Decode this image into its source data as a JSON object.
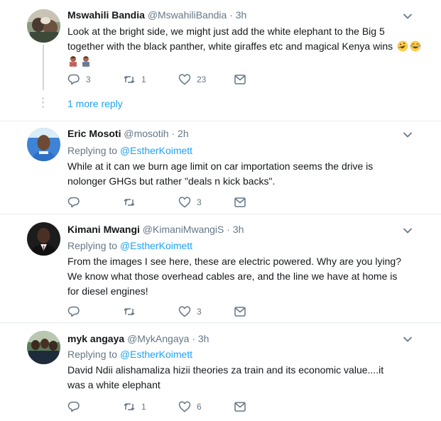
{
  "tweets": [
    {
      "name": "Mswahili Bandia",
      "handle": "@MswahiliBandia",
      "time": "3h",
      "replying_label": "",
      "replying_to": "",
      "text": "Look at the bright side, we might just add the white elephant to the Big 5 together with the black panther, white giraffes etc and magical Kenya wins",
      "reply_count": "3",
      "retweet_count": "1",
      "like_count": "23",
      "more_replies": "1 more reply"
    },
    {
      "name": "Eric Mosoti",
      "handle": "@mosotih",
      "time": "2h",
      "replying_label": "Replying to",
      "replying_to": "@EstherKoimett",
      "text": "While at it can we burn age limit on car importation seems the drive is nolonger GHGs but rather \"deals n kick backs\".",
      "reply_count": "",
      "retweet_count": "",
      "like_count": "3"
    },
    {
      "name": "Kimani Mwangi",
      "handle": "@KimaniMwangiS",
      "time": "3h",
      "replying_label": "Replying to",
      "replying_to": "@EstherKoimett",
      "text": "From the images I see here, these are electric powered. Why are you lying? We know what those overhead cables are, and the line we have at home is for diesel engines!",
      "reply_count": "",
      "retweet_count": "",
      "like_count": "3"
    },
    {
      "name": "myk angaya",
      "handle": "@MykAngaya",
      "time": "3h",
      "replying_label": "Replying to",
      "replying_to": "@EstherKoimett",
      "text": "David Ndii alishamaliza hizii theories za train and its economic value....it was a white elephant",
      "reply_count": "",
      "retweet_count": "1",
      "like_count": "6"
    }
  ],
  "dot": "·",
  "colors": {
    "link": "#1da1f2",
    "muted": "#657786",
    "text": "#14171a",
    "separator": "#e6ecf0"
  },
  "icons": [
    "reply-icon",
    "retweet-icon",
    "like-icon",
    "message-icon",
    "chevron-down-icon",
    "rofl-emoji-icon",
    "joy-emoji-icon",
    "woman-gesturing-no-emoji-icon",
    "man-gesturing-no-emoji-icon"
  ]
}
